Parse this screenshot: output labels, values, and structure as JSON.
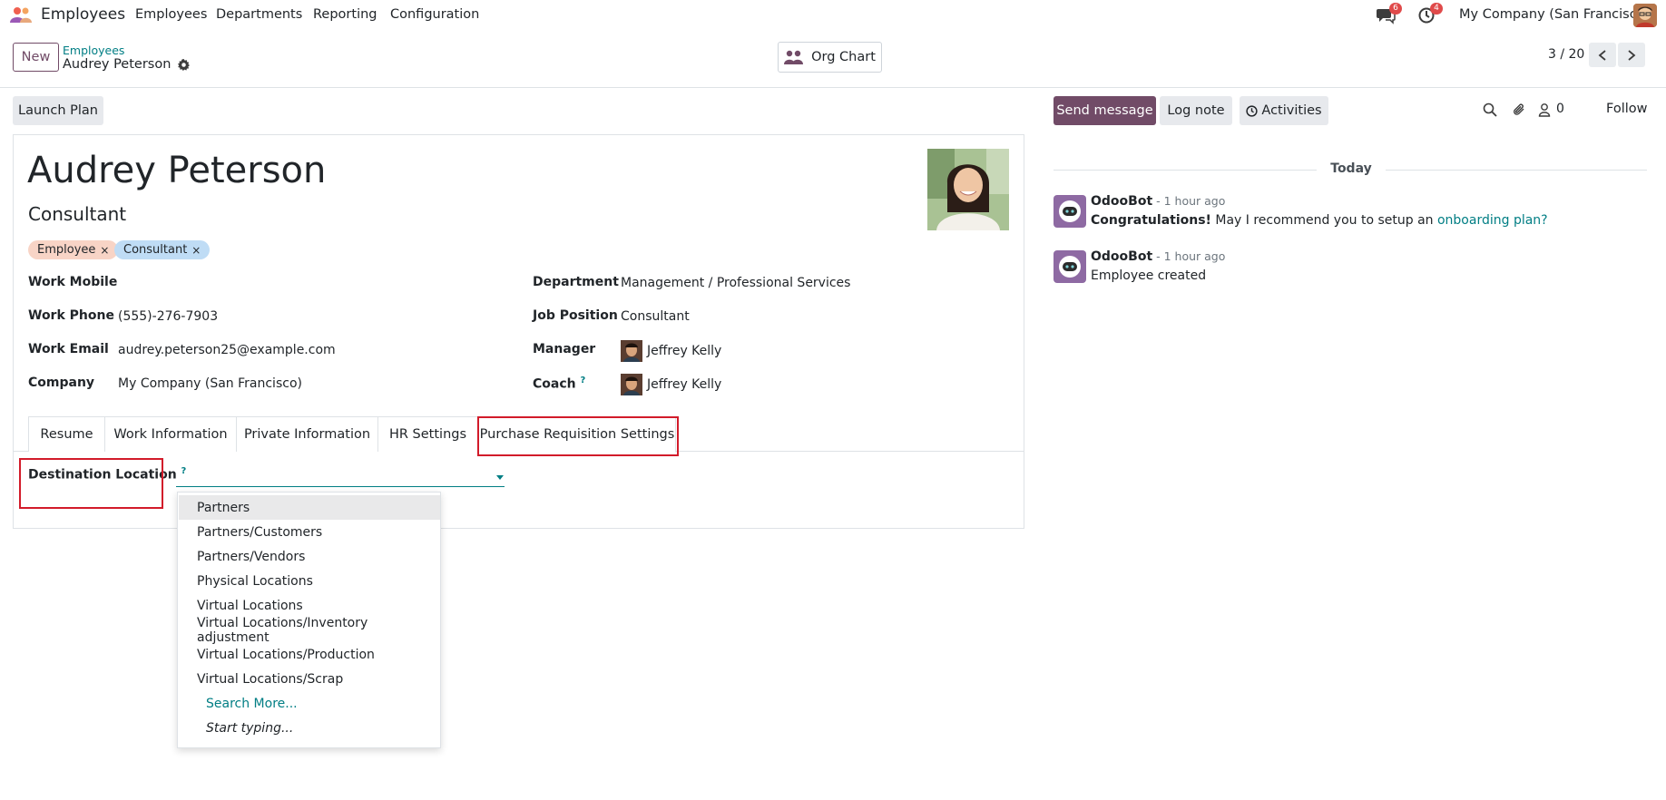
{
  "navbar": {
    "app_name": "Employees",
    "menu": [
      "Employees",
      "Departments",
      "Reporting",
      "Configuration"
    ],
    "messages_badge": "6",
    "activities_badge": "4",
    "company": "My Company (San Francisco)"
  },
  "control_panel": {
    "new_label": "New",
    "breadcrumb_parent": "Employees",
    "breadcrumb_current": "Audrey Peterson",
    "org_chart_label": "Org Chart",
    "pager": "3 / 20"
  },
  "actions": {
    "launch_plan": "Launch Plan"
  },
  "employee": {
    "name": "Audrey Peterson",
    "job_title": "Consultant",
    "tags": [
      "Employee",
      "Consultant"
    ],
    "fields_left": [
      {
        "label": "Work Mobile",
        "value": ""
      },
      {
        "label": "Work Phone",
        "value": "(555)-276-7903"
      },
      {
        "label": "Work Email",
        "value": "audrey.peterson25@example.com"
      },
      {
        "label": "Company",
        "value": "My Company (San Francisco)"
      }
    ],
    "fields_right": [
      {
        "label": "Department",
        "value": "Management / Professional Services"
      },
      {
        "label": "Job Position",
        "value": "Consultant"
      },
      {
        "label": "Manager",
        "value": "Jeffrey Kelly"
      },
      {
        "label": "Coach",
        "value": "Jeffrey Kelly"
      }
    ],
    "help_mark": "?"
  },
  "tabs": [
    "Resume",
    "Work Information",
    "Private Information",
    "HR Settings",
    "Purchase Requisition Settings"
  ],
  "destination": {
    "label": "Destination Location",
    "value": "",
    "options": [
      "Partners",
      "Partners/Customers",
      "Partners/Vendors",
      "Physical Locations",
      "Virtual Locations",
      "Virtual Locations/Inventory adjustment",
      "Virtual Locations/Production",
      "Virtual Locations/Scrap"
    ],
    "search_more": "Search More...",
    "start_typing": "Start typing..."
  },
  "chatter": {
    "send_message": "Send message",
    "log_note": "Log note",
    "activities": "Activities",
    "followers_count": "0",
    "follow": "Follow",
    "today": "Today",
    "messages": [
      {
        "author": "OdooBot",
        "time": " - 1 hour ago",
        "bold": "Congratulations!",
        "text": " May I recommend you to setup an ",
        "link": "onboarding plan?"
      },
      {
        "author": "OdooBot",
        "time": " - 1 hour ago",
        "text": "Employee created"
      }
    ]
  },
  "colors": {
    "brand": "#714b67",
    "link": "#017e84",
    "highlight": "#d21b2a"
  }
}
